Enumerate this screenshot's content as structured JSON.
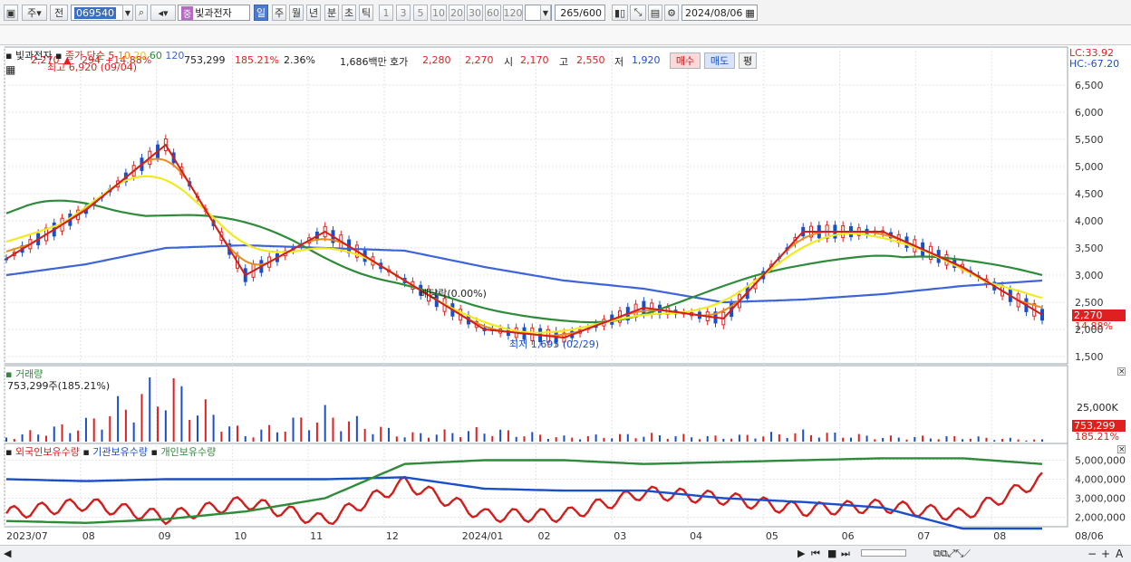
{
  "toolbar": {
    "market_label": "주",
    "prev_label": "전",
    "code": "069540",
    "jung_tag": "중",
    "stock_name": "빛과전자",
    "periods": [
      "일",
      "주",
      "월",
      "년",
      "분",
      "초",
      "틱"
    ],
    "active_period": "일",
    "intervals": [
      "1",
      "3",
      "5",
      "10",
      "20",
      "30",
      "60",
      "120"
    ],
    "count": "265",
    "count_total": "/600",
    "date": "2024/08/06"
  },
  "quote": {
    "price": "2,270",
    "change": "294",
    "change_pct": "+14.88%",
    "volume": "753,299",
    "volume_pct": "185.21%",
    "turnover_pct": "2.36%",
    "amount": "1,686백만",
    "ask_label": "호가",
    "ask1": "2,280",
    "ask2": "2,270",
    "open_label": "시",
    "open": "2,170",
    "high_label": "고",
    "high": "2,550",
    "low_label": "저",
    "low": "1,920",
    "buy_label": "매수",
    "sell_label": "매도",
    "avg_label": "평"
  },
  "price_panel": {
    "stock_name": "빛과전자",
    "ma_title": "종가 단순",
    "ma_periods": [
      "5",
      "10",
      "20",
      "60",
      "120"
    ],
    "ma_colors": [
      "#d21d1d",
      "#e98a1a",
      "#f1ea1f",
      "#2e8b3a",
      "#3d64d8"
    ],
    "high_note": "최고 6,920 (09/04)",
    "low_note": "최저 1,695 (02/29)",
    "dividend_note": "배당락(0.00%)",
    "lc": "LC:33.92",
    "hc": "HC:-67.20",
    "y_ticks": [
      "6,500",
      "6,000",
      "5,500",
      "5,000",
      "4,500",
      "4,000",
      "3,500",
      "3,000",
      "2,500",
      "2,000",
      "1,500"
    ],
    "cur_price_tag": "2,270",
    "cur_pct_tag": "14.88%"
  },
  "volume_panel": {
    "title": "거래량",
    "value": "753,299주(185.21%)",
    "y_tick": "25,000K",
    "tag_value": "753,299",
    "tag_pct": "185.21%"
  },
  "holding_panel": {
    "series": [
      "외국인보유수량",
      "기관보유수량",
      "개인보유수량"
    ],
    "y_ticks": [
      "5,000,000",
      "4,000,000",
      "3,000,000",
      "2,000,000"
    ]
  },
  "x_axis": [
    "2023/07",
    "08",
    "09",
    "10",
    "11",
    "12",
    "2024/01",
    "02",
    "03",
    "04",
    "05",
    "06",
    "07",
    "08",
    "08/06"
  ],
  "chart_data": [
    {
      "type": "line",
      "title": "빛과전자 종가 단순",
      "x": [
        "2023/07",
        "08",
        "09",
        "10",
        "11",
        "12",
        "2024/01",
        "02",
        "03",
        "04",
        "05",
        "06",
        "07",
        "08"
      ],
      "series": [
        {
          "name": "5",
          "values": [
            3300,
            4200,
            5400,
            3000,
            3800,
            2900,
            2000,
            1850,
            2400,
            2200,
            3800,
            3800,
            3150,
            2270
          ]
        },
        {
          "name": "120",
          "values": [
            3000,
            3200,
            3500,
            3550,
            3500,
            3450,
            3150,
            2900,
            2750,
            2500,
            2550,
            2650,
            2800,
            2900
          ]
        }
      ],
      "ylim": [
        1500,
        6500
      ]
    },
    {
      "type": "bar",
      "title": "거래량",
      "categories": [
        "2023/07",
        "08",
        "09",
        "10",
        "11",
        "12",
        "2024/01",
        "02",
        "03",
        "04",
        "05",
        "06",
        "07",
        "08"
      ],
      "values": [
        2000,
        8000,
        25000,
        3000,
        12000,
        3000,
        5000,
        2000,
        3000,
        2000,
        4000,
        2000,
        2000,
        753
      ]
    },
    {
      "type": "line",
      "title": "보유수량",
      "x": [
        "2023/07",
        "08",
        "09",
        "10",
        "11",
        "12",
        "2024/01",
        "02",
        "03",
        "04",
        "05",
        "06",
        "07",
        "08"
      ],
      "series": [
        {
          "name": "외국인보유수량",
          "values": [
            2200,
            2700,
            2000,
            2800,
            1800,
            3800,
            2100,
            2100,
            3300,
            3000,
            2400,
            2600,
            2100,
            4000
          ]
        },
        {
          "name": "기관보유수량",
          "values": [
            4000,
            3900,
            4000,
            4000,
            4000,
            4100,
            3500,
            3400,
            3400,
            3000,
            2800,
            2500,
            1400,
            1400
          ]
        },
        {
          "name": "개인보유수량",
          "values": [
            1800,
            1700,
            1900,
            2300,
            3000,
            4800,
            5000,
            5000,
            4800,
            4900,
            5000,
            5100,
            5100,
            4800
          ]
        }
      ],
      "ylim": [
        1500,
        5500
      ]
    }
  ]
}
